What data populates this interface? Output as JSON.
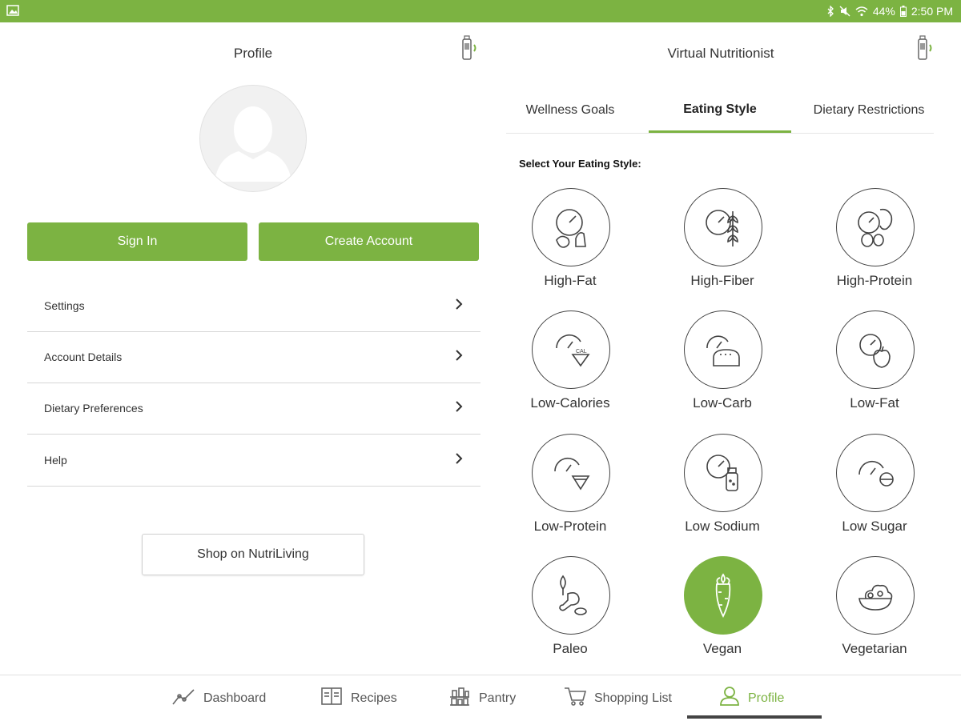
{
  "status_bar": {
    "battery": "44%",
    "time": "2:50 PM",
    "accent_color": "#7cb342"
  },
  "profile_panel": {
    "title": "Profile",
    "sign_in_label": "Sign In",
    "create_account_label": "Create Account",
    "menu_items": [
      {
        "label": "Settings"
      },
      {
        "label": "Account Details"
      },
      {
        "label": "Dietary Preferences"
      },
      {
        "label": "Help"
      }
    ],
    "shop_label": "Shop on NutriLiving"
  },
  "nutritionist_panel": {
    "title": "Virtual Nutritionist",
    "tabs": [
      {
        "label": "Wellness Goals",
        "active": false
      },
      {
        "label": "Eating Style",
        "active": true
      },
      {
        "label": "Dietary Restrictions",
        "active": false
      }
    ],
    "section_label": "Select Your Eating Style:",
    "eating_styles": [
      {
        "label": "High-Fat",
        "icon": "high-fat-icon",
        "selected": false
      },
      {
        "label": "High-Fiber",
        "icon": "high-fiber-icon",
        "selected": false
      },
      {
        "label": "High-Protein",
        "icon": "high-protein-icon",
        "selected": false
      },
      {
        "label": "Low-Calories",
        "icon": "low-calories-icon",
        "selected": false
      },
      {
        "label": "Low-Carb",
        "icon": "low-carb-icon",
        "selected": false
      },
      {
        "label": "Low-Fat",
        "icon": "low-fat-icon",
        "selected": false
      },
      {
        "label": "Low-Protein",
        "icon": "low-protein-icon",
        "selected": false
      },
      {
        "label": "Low Sodium",
        "icon": "low-sodium-icon",
        "selected": false
      },
      {
        "label": "Low Sugar",
        "icon": "low-sugar-icon",
        "selected": false
      },
      {
        "label": "Paleo",
        "icon": "paleo-icon",
        "selected": false
      },
      {
        "label": "Vegan",
        "icon": "vegan-icon",
        "selected": true
      },
      {
        "label": "Vegetarian",
        "icon": "vegetarian-icon",
        "selected": false
      }
    ]
  },
  "bottom_nav": {
    "items": [
      {
        "label": "Dashboard",
        "icon": "dashboard-icon",
        "active": false
      },
      {
        "label": "Recipes",
        "icon": "recipes-icon",
        "active": false
      },
      {
        "label": "Pantry",
        "icon": "pantry-icon",
        "active": false
      },
      {
        "label": "Shopping List",
        "icon": "shopping-cart-icon",
        "active": false
      },
      {
        "label": "Profile",
        "icon": "profile-icon",
        "active": true
      }
    ]
  }
}
